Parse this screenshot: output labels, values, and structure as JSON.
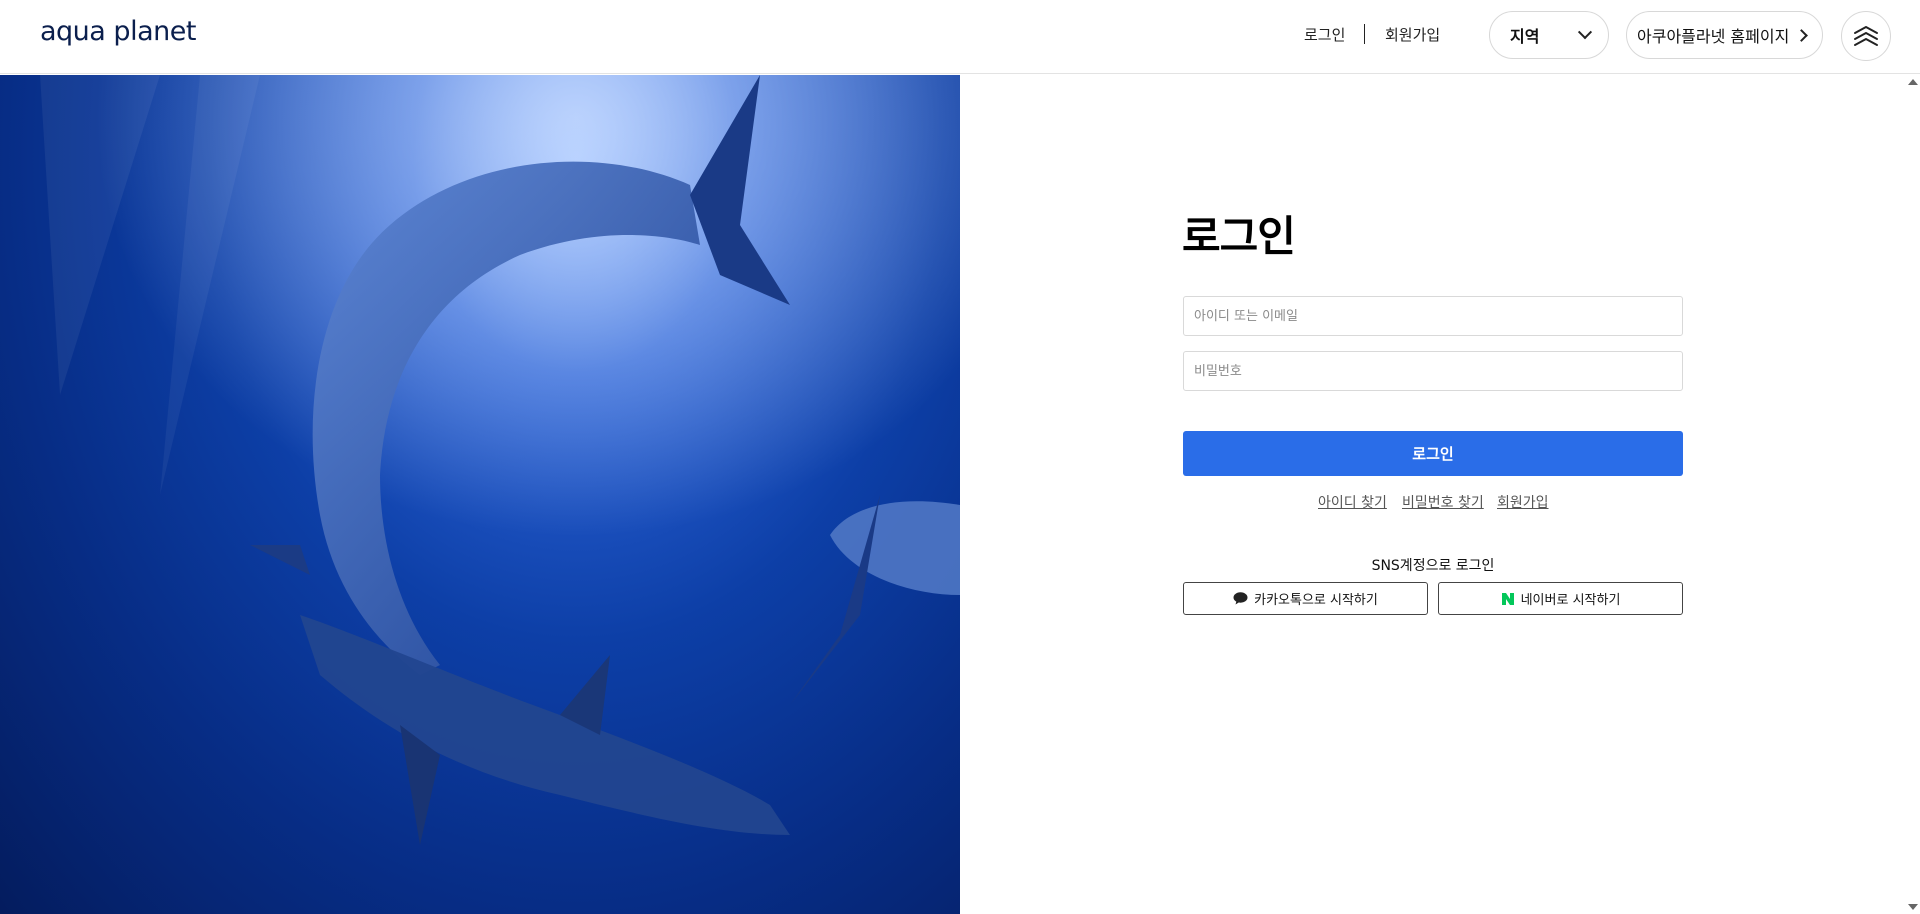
{
  "header": {
    "logo": "aqua planet",
    "login": "로그인",
    "join": "회원가입",
    "region": "지역",
    "homepage": "아쿠아플라넷 홈페이지"
  },
  "login": {
    "title": "로그인",
    "id_placeholder": "아이디 또는 이메일",
    "pw_placeholder": "비밀번호",
    "submit": "로그인",
    "find_id": "아이디 찾기",
    "find_pw": "비밀번호 찾기",
    "signup": "회원가입"
  },
  "sns": {
    "title": "SNS계정으로 로그인",
    "kakao": "카카오톡으로 시작하기",
    "naver": "네이버로 시작하기"
  },
  "colors": {
    "primary": "#2a6de8",
    "naver": "#03c75a",
    "logo": "#0b1f4d"
  }
}
